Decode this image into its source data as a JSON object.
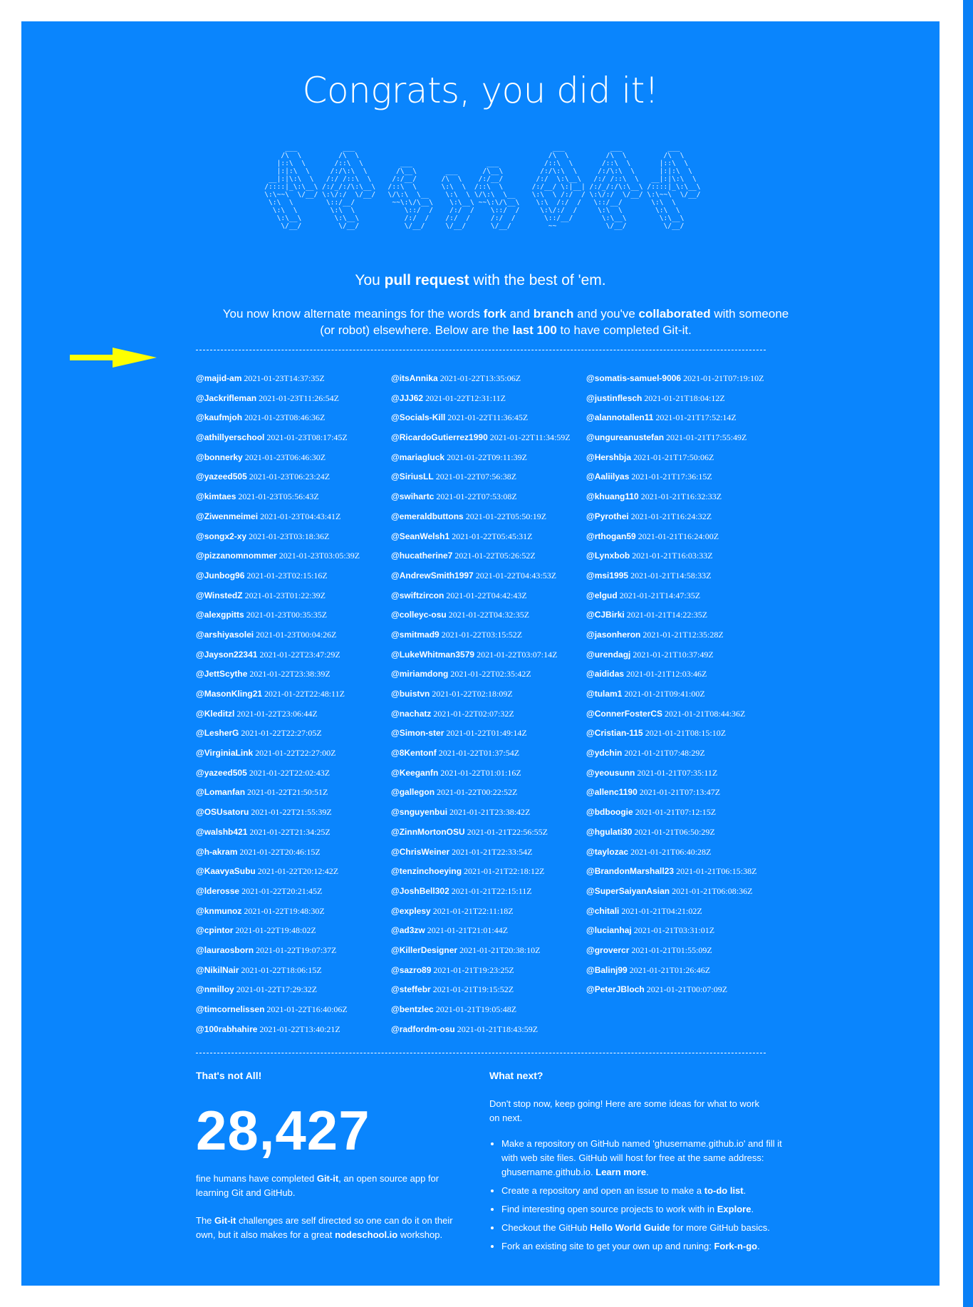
{
  "header": {
    "title": "Congrats, you did it!",
    "ascii_art": "      ___           ___                                                ___           ___           ___     \n     /\\  \\         /\\  \\                                              /\\  \\         /\\  \\         /\\  \\    \n    |::\\  \\       /::\\  \\         ___                  ___           /::\\  \\       /::\\  \\       |::\\  \\   \n    |:|:\\  \\     /:/\\:\\  \\       /\\__\\       ___      /\\__\\         /:/\\:\\  \\     /:/\\:\\  \\      |:|:\\  \\  \n  __|:|\\:\\  \\   /:/ /::\\  \\     /:/__/      /\\  \\    /:/__/        /:/  \\:\\__\\   /:/ /::\\  \\   __|:|\\:\\  \\ \n /::::|_\\:\\__\\ /:/_/:/\\:\\__\\   /::\\  \\      \\:\\  \\  /::\\  \\       /:/__/ \\:|__| /:/_/:/\\:\\__\\ /::::|_\\:\\__\\\n \\:\\~~\\  \\/__/ \\:\\/:/  \\/__/   \\/\\:\\  \\__    \\:\\  \\ \\/\\:\\  \\__    \\:\\  \\ /:/  / \\:\\/:/  \\/__/ \\:\\~~\\  \\/__/\n  \\:\\  \\        \\::/__/         ~~\\:\\/\\__\\    \\:\\__\\ ~~\\:\\/\\__\\    \\:\\  /:/  /   \\::/__/       \\:\\  \\      \n   \\:\\  \\        \\:\\  \\            \\::/  /    /:/  /    \\::/  /     \\:\\/:/  /     \\:\\  \\        \\:\\  \\     \n    \\:\\__\\        \\:\\__\\           /:/  /    /:/  /     /:/  /       \\::/__/       \\:\\__\\        \\:\\__\\    \n     \\/__/         \\/__/           \\/__/     \\/__/      \\/__/         ~~            \\/__/         \\/__/    ",
    "tagline_pre": "You ",
    "tagline_bold": "pull request",
    "tagline_post": " with the best of 'em.",
    "intro": {
      "t1": "You now know alternate meanings for the words ",
      "b1": "fork",
      "t2": " and ",
      "b2": "branch",
      "t3": " and you've ",
      "b3": "collaborated",
      "t4": " with someone (or robot) elsewhere. Below are the ",
      "b4": "last 100",
      "t5": " to have completed Git-it."
    }
  },
  "completers": [
    [
      {
        "user": "@majid-am",
        "time": "2021-01-23T14:37:35Z"
      },
      {
        "user": "@Jackrifleman",
        "time": "2021-01-23T11:26:54Z"
      },
      {
        "user": "@kaufmjoh",
        "time": "2021-01-23T08:46:36Z"
      },
      {
        "user": "@athillyerschool",
        "time": "2021-01-23T08:17:45Z"
      },
      {
        "user": "@bonnerky",
        "time": "2021-01-23T06:46:30Z"
      },
      {
        "user": "@yazeed505",
        "time": "2021-01-23T06:23:24Z"
      },
      {
        "user": "@kimtaes",
        "time": "2021-01-23T05:56:43Z"
      },
      {
        "user": "@Ziwenmeimei",
        "time": "2021-01-23T04:43:41Z"
      },
      {
        "user": "@songx2-xy",
        "time": "2021-01-23T03:18:36Z"
      },
      {
        "user": "@pizzanomnommer",
        "time": "2021-01-23T03:05:39Z"
      },
      {
        "user": "@Junbog96",
        "time": "2021-01-23T02:15:16Z"
      },
      {
        "user": "@WinstedZ",
        "time": "2021-01-23T01:22:39Z"
      },
      {
        "user": "@alexgpitts",
        "time": "2021-01-23T00:35:35Z"
      },
      {
        "user": "@arshiyasolei",
        "time": "2021-01-23T00:04:26Z"
      },
      {
        "user": "@Jayson22341",
        "time": "2021-01-22T23:47:29Z"
      },
      {
        "user": "@JettScythe",
        "time": "2021-01-22T23:38:39Z"
      },
      {
        "user": "@MasonKling21",
        "time": "2021-01-22T22:48:11Z"
      },
      {
        "user": "@Kleditzl",
        "time": "2021-01-22T23:06:44Z"
      },
      {
        "user": "@LesherG",
        "time": "2021-01-22T22:27:05Z"
      },
      {
        "user": "@VirginiaLink",
        "time": "2021-01-22T22:27:00Z"
      },
      {
        "user": "@yazeed505",
        "time": "2021-01-22T22:02:43Z"
      },
      {
        "user": "@Lomanfan",
        "time": "2021-01-22T21:50:51Z"
      },
      {
        "user": "@OSUsatoru",
        "time": "2021-01-22T21:55:39Z"
      },
      {
        "user": "@walshb421",
        "time": "2021-01-22T21:34:25Z"
      },
      {
        "user": "@h-akram",
        "time": "2021-01-22T20:46:15Z"
      },
      {
        "user": "@KaavyaSubu",
        "time": "2021-01-22T20:12:42Z"
      },
      {
        "user": "@lderosse",
        "time": "2021-01-22T20:21:45Z"
      },
      {
        "user": "@knmunoz",
        "time": "2021-01-22T19:48:30Z"
      },
      {
        "user": "@cpintor",
        "time": "2021-01-22T19:48:02Z"
      },
      {
        "user": "@lauraosborn",
        "time": "2021-01-22T19:07:37Z"
      },
      {
        "user": "@NikilNair",
        "time": "2021-01-22T18:06:15Z"
      },
      {
        "user": "@nmilloy",
        "time": "2021-01-22T17:29:32Z"
      },
      {
        "user": "@timcornelissen",
        "time": "2021-01-22T16:40:06Z"
      },
      {
        "user": "@100rabhahire",
        "time": "2021-01-22T13:40:21Z"
      }
    ],
    [
      {
        "user": "@itsAnnika",
        "time": "2021-01-22T13:35:06Z"
      },
      {
        "user": "@JJJ62",
        "time": "2021-01-22T12:31:11Z"
      },
      {
        "user": "@Socials-Kill",
        "time": "2021-01-22T11:36:45Z"
      },
      {
        "user": "@RicardoGutierrez1990",
        "time": "2021-01-22T11:34:59Z"
      },
      {
        "user": "@mariagluck",
        "time": "2021-01-22T09:11:39Z"
      },
      {
        "user": "@SiriusLL",
        "time": "2021-01-22T07:56:38Z"
      },
      {
        "user": "@swihartc",
        "time": "2021-01-22T07:53:08Z"
      },
      {
        "user": "@emeraldbuttons",
        "time": "2021-01-22T05:50:19Z"
      },
      {
        "user": "@SeanWelsh1",
        "time": "2021-01-22T05:45:31Z"
      },
      {
        "user": "@hucatherine7",
        "time": "2021-01-22T05:26:52Z"
      },
      {
        "user": "@AndrewSmith1997",
        "time": "2021-01-22T04:43:53Z"
      },
      {
        "user": "@swiftzircon",
        "time": "2021-01-22T04:42:43Z"
      },
      {
        "user": "@colleyc-osu",
        "time": "2021-01-22T04:32:35Z"
      },
      {
        "user": "@smitmad9",
        "time": "2021-01-22T03:15:52Z"
      },
      {
        "user": "@LukeWhitman3579",
        "time": "2021-01-22T03:07:14Z"
      },
      {
        "user": "@miriamdong",
        "time": "2021-01-22T02:35:42Z"
      },
      {
        "user": "@buistvn",
        "time": "2021-01-22T02:18:09Z"
      },
      {
        "user": "@nachatz",
        "time": "2021-01-22T02:07:32Z"
      },
      {
        "user": "@Simon-ster",
        "time": "2021-01-22T01:49:14Z"
      },
      {
        "user": "@8Kentonf",
        "time": "2021-01-22T01:37:54Z"
      },
      {
        "user": "@Keeganfn",
        "time": "2021-01-22T01:01:16Z"
      },
      {
        "user": "@gallegon",
        "time": "2021-01-22T00:22:52Z"
      },
      {
        "user": "@snguyenbui",
        "time": "2021-01-21T23:38:42Z"
      },
      {
        "user": "@ZinnMortonOSU",
        "time": "2021-01-21T22:56:55Z"
      },
      {
        "user": "@ChrisWeiner",
        "time": "2021-01-21T22:33:54Z"
      },
      {
        "user": "@tenzinchoeying",
        "time": "2021-01-21T22:18:12Z"
      },
      {
        "user": "@JoshBell302",
        "time": "2021-01-21T22:15:11Z"
      },
      {
        "user": "@explesy",
        "time": "2021-01-21T22:11:18Z"
      },
      {
        "user": "@ad3zw",
        "time": "2021-01-21T21:01:44Z"
      },
      {
        "user": "@KillerDesigner",
        "time": "2021-01-21T20:38:10Z"
      },
      {
        "user": "@sazro89",
        "time": "2021-01-21T19:23:25Z"
      },
      {
        "user": "@steffebr",
        "time": "2021-01-21T19:15:52Z"
      },
      {
        "user": "@bentzlec",
        "time": "2021-01-21T19:05:48Z"
      },
      {
        "user": "@radfordm-osu",
        "time": "2021-01-21T18:43:59Z"
      }
    ],
    [
      {
        "user": "@somatis-samuel-9006",
        "time": "2021-01-21T07:19:10Z"
      },
      {
        "user": "@justinflesch",
        "time": "2021-01-21T18:04:12Z"
      },
      {
        "user": "@alannotallen11",
        "time": "2021-01-21T17:52:14Z"
      },
      {
        "user": "@ungureanustefan",
        "time": "2021-01-21T17:55:49Z"
      },
      {
        "user": "@Hershbja",
        "time": "2021-01-21T17:50:06Z"
      },
      {
        "user": "@Aaliilyas",
        "time": "2021-01-21T17:36:15Z"
      },
      {
        "user": "@khuang110",
        "time": "2021-01-21T16:32:33Z"
      },
      {
        "user": "@Pyrothei",
        "time": "2021-01-21T16:24:32Z"
      },
      {
        "user": "@rthogan59",
        "time": "2021-01-21T16:24:00Z"
      },
      {
        "user": "@Lynxbob",
        "time": "2021-01-21T16:03:33Z"
      },
      {
        "user": "@msi1995",
        "time": "2021-01-21T14:58:33Z"
      },
      {
        "user": "@elgud",
        "time": "2021-01-21T14:47:35Z"
      },
      {
        "user": "@CJBirki",
        "time": "2021-01-21T14:22:35Z"
      },
      {
        "user": "@jasonheron",
        "time": "2021-01-21T12:35:28Z"
      },
      {
        "user": "@urendagj",
        "time": "2021-01-21T10:37:49Z"
      },
      {
        "user": "@aididas",
        "time": "2021-01-21T12:03:46Z"
      },
      {
        "user": "@tulam1",
        "time": "2021-01-21T09:41:00Z"
      },
      {
        "user": "@ConnerFosterCS",
        "time": "2021-01-21T08:44:36Z"
      },
      {
        "user": "@Cristian-115",
        "time": "2021-01-21T08:15:10Z"
      },
      {
        "user": "@ydchin",
        "time": "2021-01-21T07:48:29Z"
      },
      {
        "user": "@yeousunn",
        "time": "2021-01-21T07:35:11Z"
      },
      {
        "user": "@allenc1190",
        "time": "2021-01-21T07:13:47Z"
      },
      {
        "user": "@bdboogie",
        "time": "2021-01-21T07:12:15Z"
      },
      {
        "user": "@hgulati30",
        "time": "2021-01-21T06:50:29Z"
      },
      {
        "user": "@taylozac",
        "time": "2021-01-21T06:40:28Z"
      },
      {
        "user": "@BrandonMarshall23",
        "time": "2021-01-21T06:15:38Z"
      },
      {
        "user": "@SuperSaiyanAsian",
        "time": "2021-01-21T06:08:36Z"
      },
      {
        "user": "@chitali",
        "time": "2021-01-21T04:21:02Z"
      },
      {
        "user": "@lucianhaj",
        "time": "2021-01-21T03:31:01Z"
      },
      {
        "user": "@grovercr",
        "time": "2021-01-21T01:55:09Z"
      },
      {
        "user": "@Balinj99",
        "time": "2021-01-21T01:26:46Z"
      },
      {
        "user": "@PeterJBloch",
        "time": "2021-01-21T00:07:09Z"
      }
    ]
  ],
  "stats": {
    "heading": "That's not All!",
    "count": "28,427",
    "p1_pre": "fine humans have completed ",
    "p1_bold": "Git-it",
    "p1_post": ", an open source app for learning Git and GitHub.",
    "p2_pre": "The ",
    "p2_bold": "Git-it",
    "p2_mid": " challenges are self directed so one can do it on their own, but it also makes for a great ",
    "p2_bold2": "nodeschool.io",
    "p2_post": " workshop."
  },
  "next": {
    "heading": "What next?",
    "intro": "Don't stop now, keep going! Here are some ideas for what to work on next.",
    "ideas": [
      {
        "pre": "Make a repository on GitHub named 'ghusername.github.io' and fill it with web site files. GitHub will host for free at the same address: ghusername.github.io. ",
        "link": "Learn more",
        "post": "."
      },
      {
        "pre": "Create a repository and open an issue to make a ",
        "link": "to-do list",
        "post": "."
      },
      {
        "pre": "Find interesting open source projects to work with in ",
        "link": "Explore",
        "post": "."
      },
      {
        "pre": "Checkout the GitHub ",
        "link": "Hello World Guide",
        "post": " for more GitHub basics."
      },
      {
        "pre": "Fork an existing site to get your own up and runing: ",
        "link": "Fork-n-go",
        "post": "."
      }
    ]
  },
  "colors": {
    "panel": "#0a85fd",
    "arrow": "#ffff00",
    "text": "#ffffff"
  }
}
